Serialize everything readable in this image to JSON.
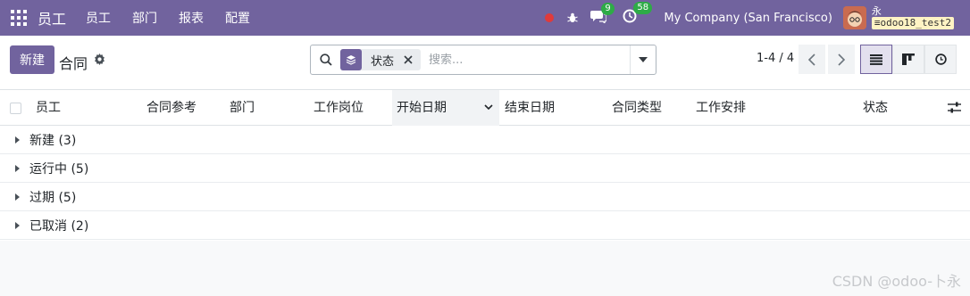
{
  "navbar": {
    "app_name": "员工",
    "menu": [
      "员工",
      "部门",
      "报表",
      "配置"
    ],
    "messages_count": "9",
    "activities_count": "58",
    "company": "My Company (San Francisco)",
    "user_name": "永",
    "database": "odoo18_test2"
  },
  "control": {
    "new_label": "新建",
    "title": "合同",
    "search": {
      "facet_label": "状态",
      "placeholder": "搜索..."
    },
    "pager": "1-4 / 4"
  },
  "columns": [
    "员工",
    "合同参考",
    "部门",
    "工作岗位",
    "开始日期",
    "结束日期",
    "合同类型",
    "工作安排",
    "状态"
  ],
  "groups": [
    {
      "label": "新建 (3)"
    },
    {
      "label": "运行中 (5)"
    },
    {
      "label": "过期 (5)"
    },
    {
      "label": "已取消 (2)"
    }
  ],
  "watermark": "CSDN @odoo-卜永"
}
